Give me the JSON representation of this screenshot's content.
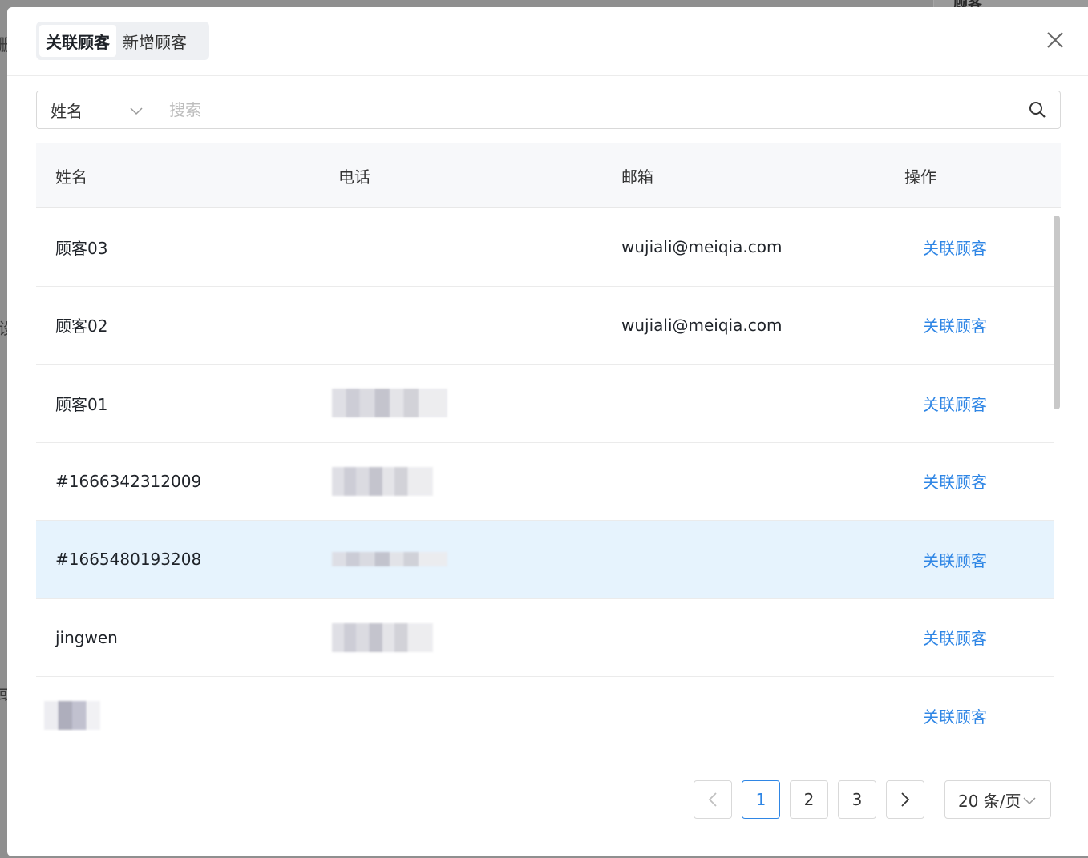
{
  "tabs": [
    {
      "label": "关联顾客",
      "active": true
    },
    {
      "label": "新增顾客",
      "active": false
    }
  ],
  "search": {
    "field": "姓名",
    "placeholder": "搜索"
  },
  "table": {
    "headers": {
      "name": "姓名",
      "phone": "电话",
      "email": "邮箱",
      "action": "操作"
    },
    "rows": [
      {
        "name": "顾客03",
        "phone": "",
        "email": "wujiali@meiqia.com",
        "action": "关联顾客"
      },
      {
        "name": "顾客02",
        "phone": "",
        "email": "wujiali@meiqia.com",
        "action": "关联顾客"
      },
      {
        "name": "顾客01",
        "phone": "[redacted]",
        "email": "",
        "action": "关联顾客"
      },
      {
        "name": "#1666342312009",
        "phone": "[redacted]",
        "email": "",
        "action": "关联顾客"
      },
      {
        "name": "#1665480193208",
        "phone": "[redacted]",
        "email": "",
        "action": "关联顾客"
      },
      {
        "name": "jingwen",
        "phone": "[redacted]",
        "email": "",
        "action": "关联顾客"
      },
      {
        "name": "[redacted]",
        "phone": "",
        "email": "",
        "action": "关联顾客"
      }
    ]
  },
  "pagination": {
    "pages": [
      "1",
      "2",
      "3"
    ],
    "current": "1",
    "page_size": "20 条/页"
  },
  "colors": {
    "accent": "#2f86e5",
    "row_highlight": "#e6f3fd"
  }
}
